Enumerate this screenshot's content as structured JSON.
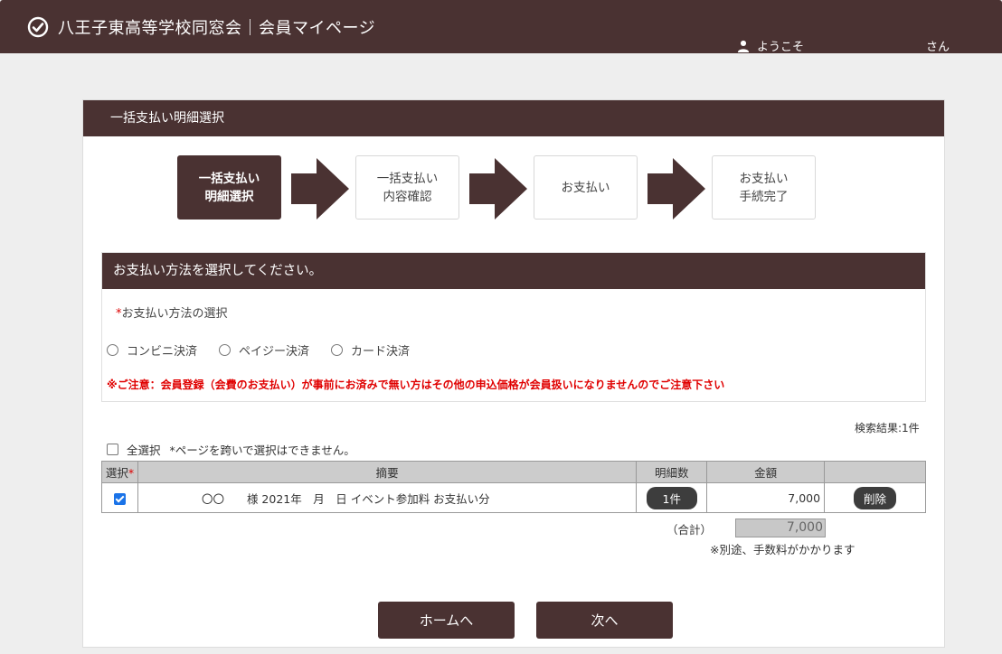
{
  "header": {
    "site_title": "八王子東高等学校同窓会｜会員マイページ",
    "welcome": "ようこそ",
    "welcome_suffix": "さん"
  },
  "page": {
    "section_title": "一括支払い明細選択"
  },
  "steps": [
    {
      "line1": "一括支払い",
      "line2": "明細選択",
      "active": true
    },
    {
      "line1": "一括支払い",
      "line2": "内容確認",
      "active": false
    },
    {
      "line1": "お支払い",
      "line2": "",
      "active": false
    },
    {
      "line1": "お支払い",
      "line2": "手続完了",
      "active": false
    }
  ],
  "payment_method": {
    "heading": "お支払い方法を選択してください。",
    "required_mark": "*",
    "label": "お支払い方法の選択",
    "options": [
      "コンビニ決済",
      "ペイジー決済",
      "カード決済"
    ],
    "notice": "※ご注意：会員登録（会費のお支払い）が事前にお済みで無い方はその他の申込価格が会員扱いになりませんのでご注意下さい"
  },
  "results": {
    "count_text": "検索結果:1件",
    "select_all_label": "全選択",
    "select_note": "*ページを跨いで選択はできません。"
  },
  "table": {
    "headers": {
      "select": "選択",
      "select_star": "*",
      "summary": "摘要",
      "detail_count": "明細数",
      "amount": "金額",
      "action": ""
    },
    "rows": [
      {
        "checked": true,
        "summary": "〇〇　　様 2021年　月　日 イベント参加料 お支払い分",
        "detail_count": "1件",
        "amount": "7,000",
        "delete_label": "削除"
      }
    ]
  },
  "totals": {
    "label": "（合計）",
    "value": "7,000",
    "fee_note": "※別途、手数料がかかります"
  },
  "buttons": {
    "home": "ホームへ",
    "next": "次へ"
  },
  "colors": {
    "brand": "#4a3232",
    "notice": "#e00000",
    "checkbox": "#1a73e8"
  }
}
